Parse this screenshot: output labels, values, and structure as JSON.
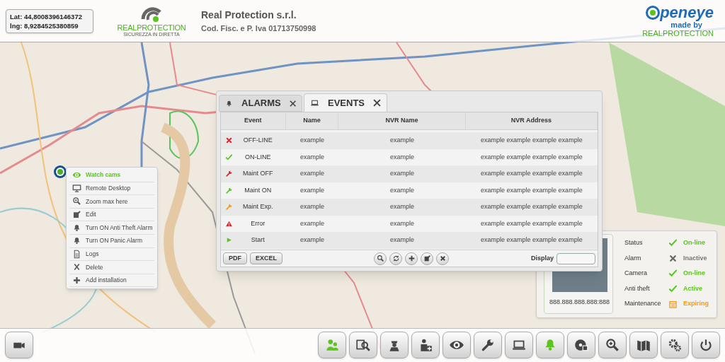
{
  "header": {
    "lat": "Lat: 44,8008396146372",
    "lng": "lng: 8,9284525380859",
    "logo_text": "REALPROTECTION",
    "logo_tagline": "SICUREZZA IN DIRETTA",
    "company": "Real Protection s.r.l.",
    "fiscal": "Cod. Fisc. e P. Iva 01713750998",
    "brand": "peneye",
    "brand_sub": "made by",
    "brand_company": "REALPROTECTION"
  },
  "panel": {
    "tabs": [
      {
        "label": "ALARMS",
        "selected": false
      },
      {
        "label": "EVENTS",
        "selected": true
      }
    ],
    "columns": [
      "Event",
      "Name",
      "NVR Name",
      "NVR Address"
    ],
    "rows": [
      {
        "kind": "cross",
        "event": "OFF-LINE",
        "name": "example",
        "nvr_name": "example",
        "nvr_address": "example example example example"
      },
      {
        "kind": "check",
        "event": "ON-LINE",
        "name": "example",
        "nvr_name": "example",
        "nvr_address": "example example example example"
      },
      {
        "kind": "wrench-red",
        "event": "Maint OFF",
        "name": "example",
        "nvr_name": "example",
        "nvr_address": "example example example example"
      },
      {
        "kind": "wrench-green",
        "event": "Maint ON",
        "name": "example",
        "nvr_name": "example",
        "nvr_address": "example example example example"
      },
      {
        "kind": "wrench-orange",
        "event": "Maint Exp.",
        "name": "example",
        "nvr_name": "example",
        "nvr_address": "example example example example"
      },
      {
        "kind": "warning",
        "event": "Error",
        "name": "example",
        "nvr_name": "example",
        "nvr_address": "example example example example"
      },
      {
        "kind": "play",
        "event": "Start",
        "name": "example",
        "nvr_name": "example",
        "nvr_address": "example example example example"
      }
    ],
    "export_buttons": [
      "PDF",
      "EXCEL"
    ],
    "display_label": "Display"
  },
  "context_menu": [
    {
      "label": "Watch cams",
      "selected": true
    },
    {
      "label": "Remote Desktop",
      "selected": false
    },
    {
      "label": "Zoom max here",
      "selected": false
    },
    {
      "label": "Edit",
      "selected": false
    },
    {
      "label": "Turn ON Anti Theft Alarm",
      "selected": false
    },
    {
      "label": "Turn ON Panic Alarm",
      "selected": false
    },
    {
      "label": "Logs",
      "selected": false
    },
    {
      "label": "Delete",
      "selected": false
    },
    {
      "label": "Add installation",
      "selected": false
    }
  ],
  "status_card": {
    "address": "888.888.888.888:888",
    "rows": [
      {
        "label": "Status",
        "kind": "check",
        "value": "On-line",
        "color": "#5cc41f"
      },
      {
        "label": "Alarm",
        "kind": "cross",
        "value": "Inactive",
        "color": "#777777"
      },
      {
        "label": "Camera",
        "kind": "check",
        "value": "On-line",
        "color": "#5cc41f"
      },
      {
        "label": "Anti theft",
        "kind": "check",
        "value": "Active",
        "color": "#5cc41f"
      },
      {
        "label": "Maintenance",
        "kind": "calendar",
        "value": "Expiring",
        "color": "#f39a1b"
      }
    ]
  },
  "toolbar": [
    {
      "active": false
    },
    {
      "active": true
    },
    {
      "active": false
    },
    {
      "active": false
    },
    {
      "active": false
    },
    {
      "active": false
    },
    {
      "active": false
    },
    {
      "active": false
    },
    {
      "active": true
    },
    {
      "active": false
    },
    {
      "active": false
    },
    {
      "active": false
    },
    {
      "active": false
    },
    {
      "active": false
    }
  ]
}
